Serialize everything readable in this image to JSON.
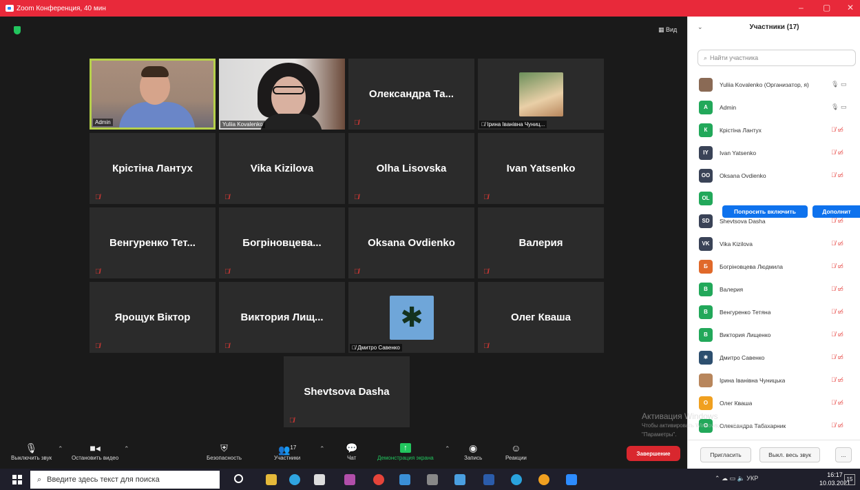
{
  "window": {
    "title": "Zoom Конференция, 40 мин"
  },
  "view_button": "▦ Вид",
  "tiles": [
    {
      "label": "Admin",
      "type": "video-admin",
      "active": true
    },
    {
      "label": "Yuliia Kovalenko",
      "type": "video-yuliia"
    },
    {
      "label": "Олександра  Та...",
      "type": "name",
      "muted": true
    },
    {
      "label": "Ірина Іванівна Чуниц...",
      "type": "thumb-irina",
      "muted": true
    },
    {
      "label": "Крістіна Лантух",
      "type": "name",
      "muted": true
    },
    {
      "label": "Vika Kizilova",
      "type": "name",
      "muted": true
    },
    {
      "label": "Olha Lisovska",
      "type": "name",
      "muted": true
    },
    {
      "label": "Ivan Yatsenko",
      "type": "name",
      "muted": true
    },
    {
      "label": "Венгуренко  Тет...",
      "type": "name",
      "muted": true
    },
    {
      "label": "Богріновцева...",
      "type": "name",
      "muted": true
    },
    {
      "label": "Oksana Ovdienko",
      "type": "name",
      "muted": true
    },
    {
      "label": "Валерия",
      "type": "name",
      "muted": true
    },
    {
      "label": "Ярощук Віктор",
      "type": "name",
      "muted": true
    },
    {
      "label": "Виктория  Лищ...",
      "type": "name",
      "muted": true
    },
    {
      "label": "Дмитро Савенко",
      "type": "thumb-palm",
      "muted": true
    },
    {
      "label": "Олег Кваша",
      "type": "name",
      "muted": true
    },
    {
      "label": "Shevtsova Dasha",
      "type": "name",
      "muted": true
    }
  ],
  "toolbar": {
    "mute": "Выключить звук",
    "video": "Остановить видео",
    "security": "Безопасность",
    "participants": "Участники",
    "participants_count": "17",
    "chat": "Чат",
    "share": "Демонстрация экрана",
    "record": "Запись",
    "reactions": "Реакции",
    "end": "Завершение"
  },
  "watermark": {
    "line1": "Активация Windows",
    "line2": "Чтобы активировать Windows, перейдите в раздел",
    "line3": "\"Параметры\"."
  },
  "panel": {
    "title": "Участники (17)",
    "search_placeholder": "Найти участника",
    "participants": [
      {
        "name": "Yuliia Kovalenko (Организатор, я)",
        "initials": "",
        "color": "#8a6a55",
        "status": "🎙 ▭",
        "ok": true
      },
      {
        "name": "Admin",
        "initials": "A",
        "color": "#22a85a",
        "status": "🎙 ▭",
        "ok": true
      },
      {
        "name": "Крістіна Лантух",
        "initials": "К",
        "color": "#22a85a",
        "status": "🎙̸ ▭̸"
      },
      {
        "name": "Ivan Yatsenko",
        "initials": "IY",
        "color": "#3a4357",
        "status": "🎙̸ ▭̸"
      },
      {
        "name": "Oksana Ovdienko",
        "initials": "OO",
        "color": "#3a4357",
        "status": "🎙̸ ▭̸"
      },
      {
        "name": "",
        "initials": "OL",
        "color": "#22a85a",
        "status": "",
        "hover": true
      },
      {
        "name": "Shevtsova Dasha",
        "initials": "SD",
        "color": "#3a4357",
        "status": "🎙̸ ▭̸"
      },
      {
        "name": "Vika Kizilova",
        "initials": "VK",
        "color": "#3a4357",
        "status": "🎙̸ ▭̸"
      },
      {
        "name": "Богріновцева Людмила",
        "initials": "Б",
        "color": "#e0692a",
        "status": "🎙̸ ▭̸"
      },
      {
        "name": "Валерия",
        "initials": "В",
        "color": "#22a85a",
        "status": "🎙̸ ▭̸"
      },
      {
        "name": "Венгуренко Тетяна",
        "initials": "В",
        "color": "#22a85a",
        "status": "🎙̸ ▭̸"
      },
      {
        "name": "Виктория Лищенко",
        "initials": "В",
        "color": "#22a85a",
        "status": "🎙̸ ▭̸"
      },
      {
        "name": "Дмитро Савенко",
        "initials": "✱",
        "color": "#2d4f6f",
        "status": "🎙̸ ▭̸"
      },
      {
        "name": "Ірина Іванівна Чуницька",
        "initials": "",
        "color": "#b8865c",
        "status": "🎙̸ ▭̸"
      },
      {
        "name": "Олег Кваша",
        "initials": "О",
        "color": "#f0a020",
        "status": "🎙̸ ▭̸"
      },
      {
        "name": "Олександра Табахарник",
        "initials": "О",
        "color": "#22a85a",
        "status": "🎙̸ ▭̸"
      }
    ],
    "ask_unmute": "Попросить включить",
    "more": "Дополнит",
    "invite": "Пригласить",
    "mute_all": "Выкл. весь звук",
    "more_menu": "..."
  },
  "taskbar": {
    "search_placeholder": "Введите здесь текст для поиска",
    "lang": "УКР",
    "time": "16:17",
    "date": "10.03.2021",
    "notifications": "15"
  }
}
